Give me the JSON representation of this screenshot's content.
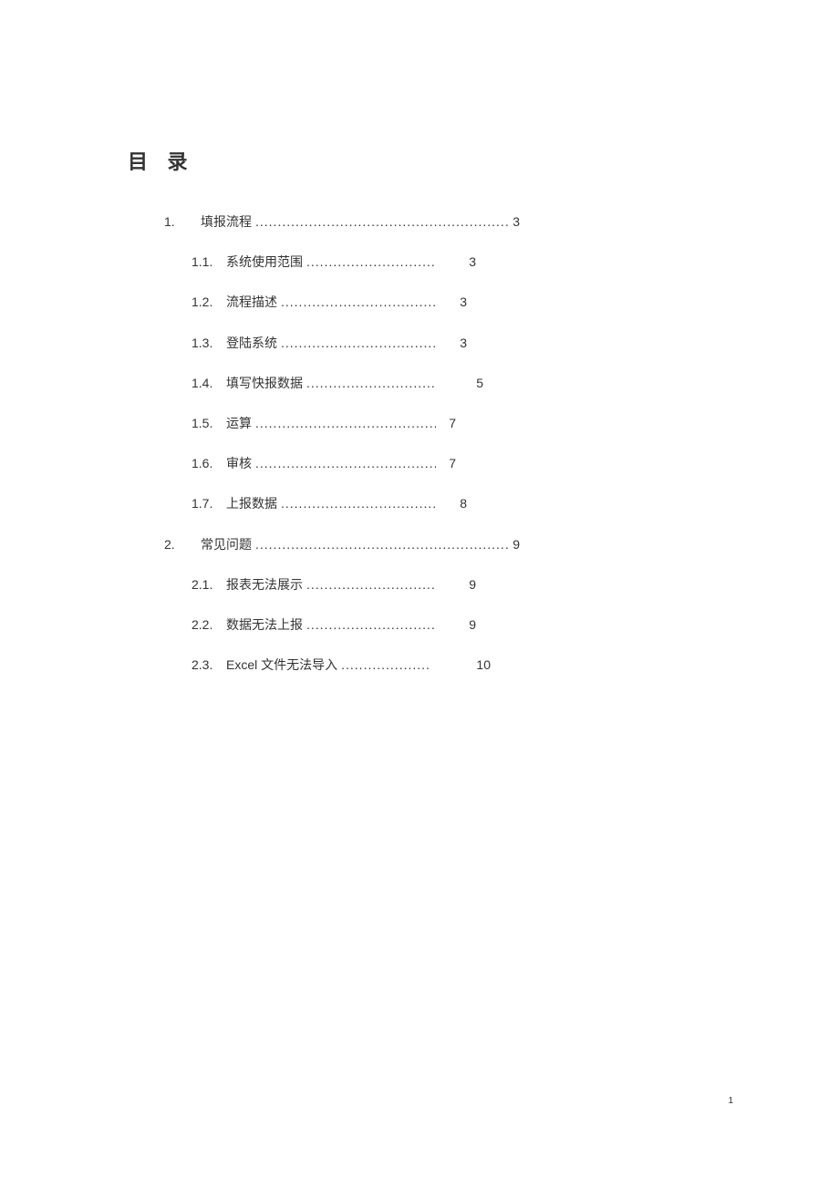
{
  "title": "目 录",
  "page_number": "1",
  "toc": [
    {
      "level": 1,
      "num": "1.",
      "label": "填报流程",
      "page": "3",
      "pad": 0
    },
    {
      "level": 2,
      "num": "1.1.",
      "label": "系统使用范围",
      "page": "3",
      "pad": 32
    },
    {
      "level": 2,
      "num": "1.2.",
      "label": "流程描述",
      "page": "3",
      "pad": 22
    },
    {
      "level": 2,
      "num": "1.3.",
      "label": "登陆系统",
      "page": "3",
      "pad": 22
    },
    {
      "level": 2,
      "num": "1.4.",
      "label": "填写快报数据",
      "page": "5",
      "pad": 40
    },
    {
      "level": 2,
      "num": "1.5.",
      "label": " 运算",
      "page": "7",
      "pad": 10
    },
    {
      "level": 2,
      "num": "1.6.",
      "label": " 审核",
      "page": "7",
      "pad": 10
    },
    {
      "level": 2,
      "num": "1.7.",
      "label": "上报数据",
      "page": "8",
      "pad": 22
    },
    {
      "level": 1,
      "num": "2.",
      "label": "常见问题",
      "page": "9",
      "pad": 0
    },
    {
      "level": 2,
      "num": "2.1.",
      "label": "报表无法展示",
      "page": "9",
      "pad": 32
    },
    {
      "level": 2,
      "num": "2.2.",
      "label": "数据无法上报",
      "page": "9",
      "pad": 32
    },
    {
      "level": 2,
      "num": "2.3.",
      "label": "Excel 文件无法导入",
      "page": "10",
      "pad": 48
    }
  ]
}
